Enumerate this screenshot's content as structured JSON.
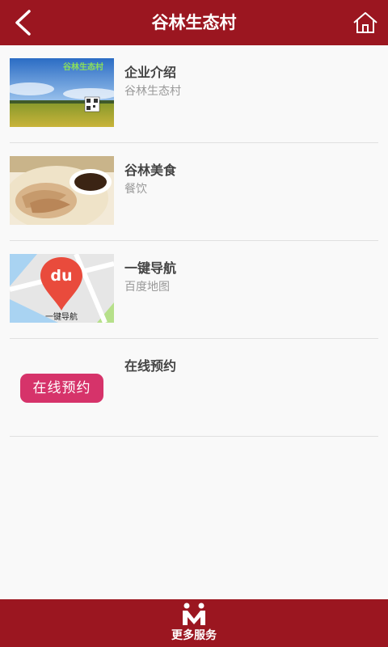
{
  "header": {
    "title": "谷林生态村",
    "back_icon": "chevron-left-icon",
    "home_icon": "home-icon",
    "background_color": "#9b1620"
  },
  "items": [
    {
      "title": "企业介绍",
      "subtitle": "谷林生态村",
      "image": "rice-field-photo",
      "image_caption": "谷林生态村"
    },
    {
      "title": "谷林美食",
      "subtitle": "餐饮",
      "image": "food-photo"
    },
    {
      "title": "一键导航",
      "subtitle": "百度地图",
      "image": "baidu-map-icon",
      "map_badge": "du",
      "map_caption": "一键导航"
    },
    {
      "title": "在线预约",
      "subtitle": "",
      "image": "reserve-badge",
      "badge_label": "在线预约",
      "badge_color": "#d6336a"
    }
  ],
  "footer": {
    "label": "更多服务",
    "icon": "people-icon"
  }
}
